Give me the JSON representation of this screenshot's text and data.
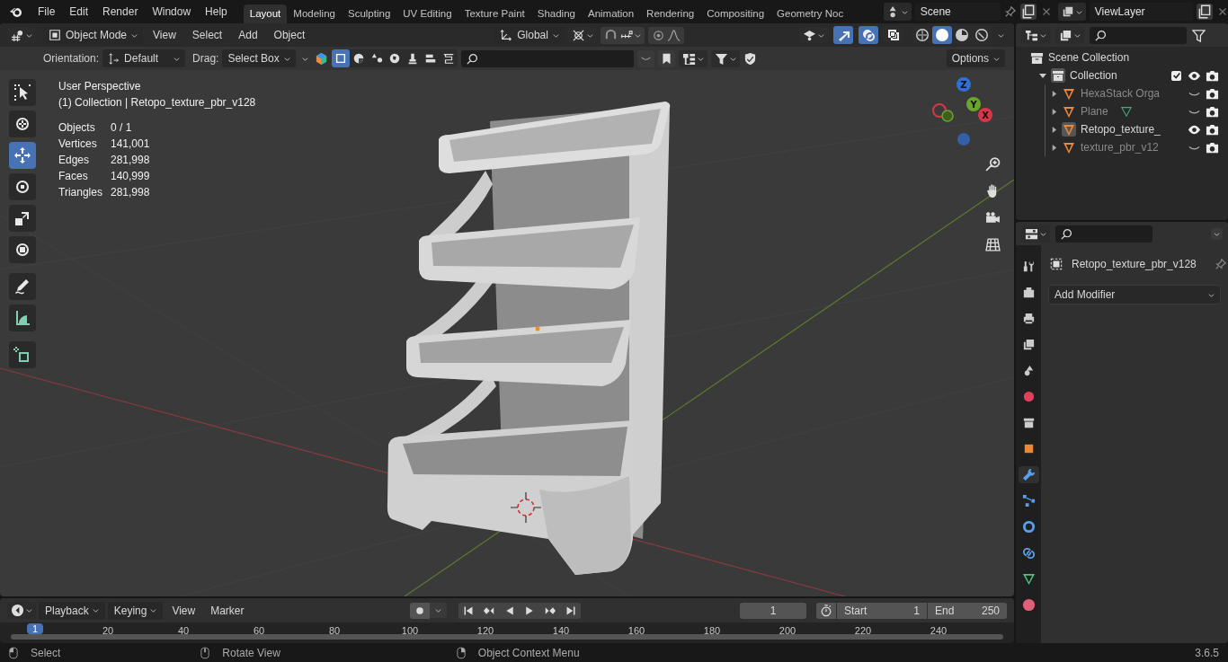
{
  "menu": [
    "File",
    "Edit",
    "Render",
    "Window",
    "Help"
  ],
  "workspaces": [
    {
      "label": "Layout",
      "selected": true
    },
    {
      "label": "Modeling",
      "selected": false
    },
    {
      "label": "Sculpting",
      "selected": false
    },
    {
      "label": "UV Editing",
      "selected": false
    },
    {
      "label": "Texture Paint",
      "selected": false
    },
    {
      "label": "Shading",
      "selected": false
    },
    {
      "label": "Animation",
      "selected": false
    },
    {
      "label": "Rendering",
      "selected": false
    },
    {
      "label": "Compositing",
      "selected": false
    },
    {
      "label": "Geometry Noc",
      "selected": false
    }
  ],
  "scene": "Scene",
  "view_layer": "ViewLayer",
  "viewport_header": {
    "mode": "Object Mode",
    "menus": [
      "View",
      "Select",
      "Add",
      "Object"
    ],
    "orientation": "Global"
  },
  "viewport_toggles": [
    {
      "kind": "gizmos",
      "on": true
    },
    {
      "kind": "overlays",
      "on": true
    },
    {
      "kind": "xray",
      "on": false
    }
  ],
  "shading": [
    {
      "kind": "wireframe",
      "selected": false
    },
    {
      "kind": "solid",
      "selected": true
    },
    {
      "kind": "material",
      "selected": false
    },
    {
      "kind": "rendered",
      "selected": false
    }
  ],
  "tool_settings": {
    "orientation_label": "Orientation:",
    "orientation": "Default",
    "drag_label": "Drag:",
    "drag": "Select Box",
    "options": "Options"
  },
  "viewport_info": {
    "title": "User Perspective",
    "context": "(1) Collection | Retopo_texture_pbr_v128",
    "stats": [
      {
        "label": "Objects",
        "value": "0 / 1"
      },
      {
        "label": "Vertices",
        "value": "141,001"
      },
      {
        "label": "Edges",
        "value": "281,998"
      },
      {
        "label": "Faces",
        "value": "140,999"
      },
      {
        "label": "Triangles",
        "value": "281,998"
      }
    ]
  },
  "tools": [
    {
      "kind": "select",
      "selected": false
    },
    {
      "kind": "cursor",
      "selected": false
    },
    {
      "kind": "move",
      "selected": true
    },
    {
      "kind": "rotate",
      "selected": false
    },
    {
      "kind": "scale",
      "selected": false
    },
    {
      "kind": "transform",
      "selected": false
    },
    {
      "kind": "annotate",
      "selected": false
    },
    {
      "kind": "measure",
      "selected": false
    },
    {
      "kind": "add_cube",
      "selected": false
    }
  ],
  "gizmo_axes": [
    {
      "label": "Z",
      "color": "#2f6fd6"
    },
    {
      "label": "Y",
      "color": "#6ba52a"
    },
    {
      "label": "X",
      "color": "#d8374a"
    }
  ],
  "outliner": {
    "root": "Scene Collection",
    "collection": {
      "label": "Collection",
      "expanded": true,
      "checked": true,
      "visible": true,
      "children": [
        {
          "label": "HexaStack Orga",
          "visible": false,
          "active": false,
          "show_data": false
        },
        {
          "label": "Plane",
          "visible": false,
          "active": false,
          "show_data": true
        },
        {
          "label": "Retopo_texture_",
          "visible": true,
          "active": true,
          "show_data": false
        },
        {
          "label": "texture_pbr_v12",
          "visible": false,
          "active": false,
          "show_data": false
        }
      ]
    }
  },
  "properties": {
    "object": "Retopo_texture_pbr_v128",
    "add_modifier": "Add Modifier",
    "tabs": [
      {
        "kind": "tool",
        "selected": false
      },
      {
        "kind": "render",
        "selected": false
      },
      {
        "kind": "output",
        "selected": false
      },
      {
        "kind": "view_layer",
        "selected": false
      },
      {
        "kind": "scene",
        "selected": false
      },
      {
        "kind": "world",
        "selected": false
      },
      {
        "kind": "collection",
        "selected": false
      },
      {
        "kind": "object",
        "selected": false
      },
      {
        "kind": "modifier",
        "selected": true
      },
      {
        "kind": "particles",
        "selected": false
      },
      {
        "kind": "physics",
        "selected": false
      },
      {
        "kind": "constraints",
        "selected": false
      },
      {
        "kind": "data",
        "selected": false
      },
      {
        "kind": "material",
        "selected": false
      }
    ]
  },
  "timeline": {
    "menus": [
      "Playback",
      "Keying",
      "View",
      "Marker"
    ],
    "current_frame": "1",
    "start_label": "Start",
    "start": "1",
    "end_label": "End",
    "end": "250",
    "playhead": "1",
    "ruler": [
      "20",
      "40",
      "60",
      "80",
      "100",
      "120",
      "140",
      "160",
      "180",
      "200",
      "220",
      "240"
    ]
  },
  "status_bar": {
    "hints": [
      "Select",
      "Rotate View",
      "Object Context Menu"
    ],
    "version": "3.6.5"
  }
}
